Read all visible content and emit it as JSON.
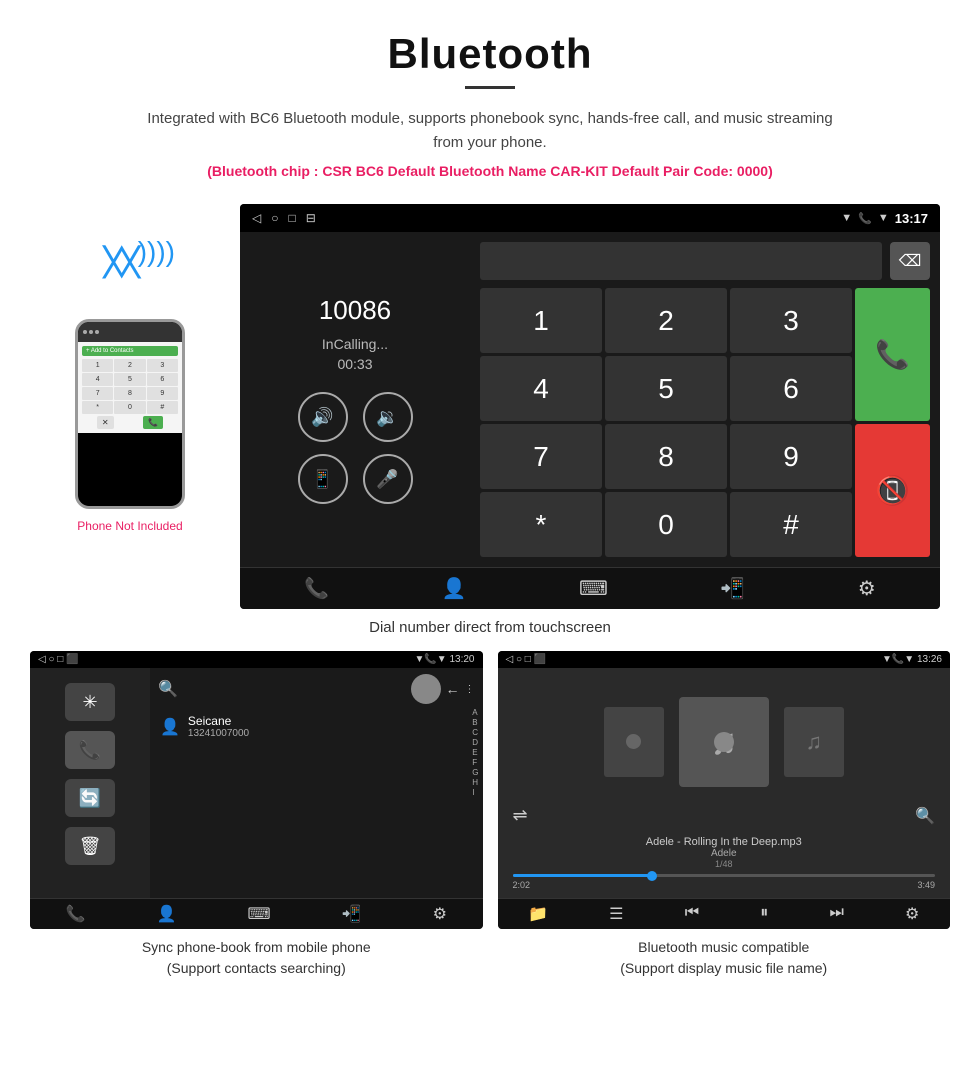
{
  "header": {
    "title": "Bluetooth",
    "description": "Integrated with BC6 Bluetooth module, supports phonebook sync, hands-free call, and music streaming from your phone.",
    "chip_info": "(Bluetooth chip : CSR BC6    Default Bluetooth Name CAR-KIT    Default Pair Code: 0000)"
  },
  "phone_illustration": {
    "not_included_label": "Phone Not Included"
  },
  "dial_screen": {
    "status_time": "13:17",
    "nav_icons": [
      "◁",
      "○",
      "□",
      "⬛"
    ],
    "number": "10086",
    "status": "InCalling...",
    "timer": "00:33",
    "numpad": [
      "1",
      "2",
      "3",
      "4",
      "5",
      "6",
      "7",
      "8",
      "9"
    ],
    "special_keys": [
      "*",
      "0",
      "#"
    ]
  },
  "dial_caption": "Dial number direct from touchscreen",
  "phonebook_screen": {
    "status_time": "13:20",
    "contact_name": "Seicane",
    "contact_number": "13241007000",
    "alpha_list": [
      "A",
      "B",
      "C",
      "D",
      "E",
      "F",
      "G",
      "H",
      "I"
    ]
  },
  "phonebook_caption_line1": "Sync phone-book from mobile phone",
  "phonebook_caption_line2": "(Support contacts searching)",
  "music_screen": {
    "status_time": "13:26",
    "track_name": "Adele - Rolling In the Deep.mp3",
    "artist": "Adele",
    "track_num": "1/48",
    "time_current": "2:02",
    "time_total": "3:49",
    "progress_percent": 33
  },
  "music_caption_line1": "Bluetooth music compatible",
  "music_caption_line2": "(Support display music file name)"
}
